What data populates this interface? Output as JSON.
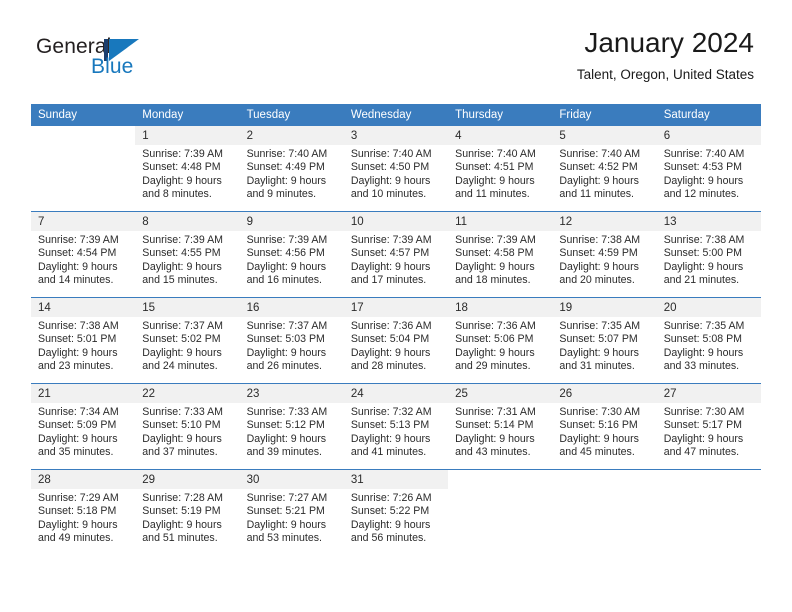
{
  "brand": {
    "name_part1": "General",
    "name_part2": "Blue",
    "mark": "triangle-flag-logo",
    "accent_color": "#1878bd",
    "dark_color": "#1c3f6e"
  },
  "header": {
    "month_title": "January 2024",
    "location": "Talent, Oregon, United States"
  },
  "theme": {
    "header_blue": "#3a7cbe",
    "daynum_band": "#f1f1f1",
    "text": "#2b2b2b"
  },
  "calendar": {
    "weekday_headers": [
      "Sunday",
      "Monday",
      "Tuesday",
      "Wednesday",
      "Thursday",
      "Friday",
      "Saturday"
    ],
    "weeks": [
      {
        "days": [
          {
            "num": "",
            "sunrise": "",
            "sunset": "",
            "daylight1": "",
            "daylight2": ""
          },
          {
            "num": "1",
            "sunrise": "Sunrise: 7:39 AM",
            "sunset": "Sunset: 4:48 PM",
            "daylight1": "Daylight: 9 hours",
            "daylight2": "and 8 minutes."
          },
          {
            "num": "2",
            "sunrise": "Sunrise: 7:40 AM",
            "sunset": "Sunset: 4:49 PM",
            "daylight1": "Daylight: 9 hours",
            "daylight2": "and 9 minutes."
          },
          {
            "num": "3",
            "sunrise": "Sunrise: 7:40 AM",
            "sunset": "Sunset: 4:50 PM",
            "daylight1": "Daylight: 9 hours",
            "daylight2": "and 10 minutes."
          },
          {
            "num": "4",
            "sunrise": "Sunrise: 7:40 AM",
            "sunset": "Sunset: 4:51 PM",
            "daylight1": "Daylight: 9 hours",
            "daylight2": "and 11 minutes."
          },
          {
            "num": "5",
            "sunrise": "Sunrise: 7:40 AM",
            "sunset": "Sunset: 4:52 PM",
            "daylight1": "Daylight: 9 hours",
            "daylight2": "and 11 minutes."
          },
          {
            "num": "6",
            "sunrise": "Sunrise: 7:40 AM",
            "sunset": "Sunset: 4:53 PM",
            "daylight1": "Daylight: 9 hours",
            "daylight2": "and 12 minutes."
          }
        ]
      },
      {
        "days": [
          {
            "num": "7",
            "sunrise": "Sunrise: 7:39 AM",
            "sunset": "Sunset: 4:54 PM",
            "daylight1": "Daylight: 9 hours",
            "daylight2": "and 14 minutes."
          },
          {
            "num": "8",
            "sunrise": "Sunrise: 7:39 AM",
            "sunset": "Sunset: 4:55 PM",
            "daylight1": "Daylight: 9 hours",
            "daylight2": "and 15 minutes."
          },
          {
            "num": "9",
            "sunrise": "Sunrise: 7:39 AM",
            "sunset": "Sunset: 4:56 PM",
            "daylight1": "Daylight: 9 hours",
            "daylight2": "and 16 minutes."
          },
          {
            "num": "10",
            "sunrise": "Sunrise: 7:39 AM",
            "sunset": "Sunset: 4:57 PM",
            "daylight1": "Daylight: 9 hours",
            "daylight2": "and 17 minutes."
          },
          {
            "num": "11",
            "sunrise": "Sunrise: 7:39 AM",
            "sunset": "Sunset: 4:58 PM",
            "daylight1": "Daylight: 9 hours",
            "daylight2": "and 18 minutes."
          },
          {
            "num": "12",
            "sunrise": "Sunrise: 7:38 AM",
            "sunset": "Sunset: 4:59 PM",
            "daylight1": "Daylight: 9 hours",
            "daylight2": "and 20 minutes."
          },
          {
            "num": "13",
            "sunrise": "Sunrise: 7:38 AM",
            "sunset": "Sunset: 5:00 PM",
            "daylight1": "Daylight: 9 hours",
            "daylight2": "and 21 minutes."
          }
        ]
      },
      {
        "days": [
          {
            "num": "14",
            "sunrise": "Sunrise: 7:38 AM",
            "sunset": "Sunset: 5:01 PM",
            "daylight1": "Daylight: 9 hours",
            "daylight2": "and 23 minutes."
          },
          {
            "num": "15",
            "sunrise": "Sunrise: 7:37 AM",
            "sunset": "Sunset: 5:02 PM",
            "daylight1": "Daylight: 9 hours",
            "daylight2": "and 24 minutes."
          },
          {
            "num": "16",
            "sunrise": "Sunrise: 7:37 AM",
            "sunset": "Sunset: 5:03 PM",
            "daylight1": "Daylight: 9 hours",
            "daylight2": "and 26 minutes."
          },
          {
            "num": "17",
            "sunrise": "Sunrise: 7:36 AM",
            "sunset": "Sunset: 5:04 PM",
            "daylight1": "Daylight: 9 hours",
            "daylight2": "and 28 minutes."
          },
          {
            "num": "18",
            "sunrise": "Sunrise: 7:36 AM",
            "sunset": "Sunset: 5:06 PM",
            "daylight1": "Daylight: 9 hours",
            "daylight2": "and 29 minutes."
          },
          {
            "num": "19",
            "sunrise": "Sunrise: 7:35 AM",
            "sunset": "Sunset: 5:07 PM",
            "daylight1": "Daylight: 9 hours",
            "daylight2": "and 31 minutes."
          },
          {
            "num": "20",
            "sunrise": "Sunrise: 7:35 AM",
            "sunset": "Sunset: 5:08 PM",
            "daylight1": "Daylight: 9 hours",
            "daylight2": "and 33 minutes."
          }
        ]
      },
      {
        "days": [
          {
            "num": "21",
            "sunrise": "Sunrise: 7:34 AM",
            "sunset": "Sunset: 5:09 PM",
            "daylight1": "Daylight: 9 hours",
            "daylight2": "and 35 minutes."
          },
          {
            "num": "22",
            "sunrise": "Sunrise: 7:33 AM",
            "sunset": "Sunset: 5:10 PM",
            "daylight1": "Daylight: 9 hours",
            "daylight2": "and 37 minutes."
          },
          {
            "num": "23",
            "sunrise": "Sunrise: 7:33 AM",
            "sunset": "Sunset: 5:12 PM",
            "daylight1": "Daylight: 9 hours",
            "daylight2": "and 39 minutes."
          },
          {
            "num": "24",
            "sunrise": "Sunrise: 7:32 AM",
            "sunset": "Sunset: 5:13 PM",
            "daylight1": "Daylight: 9 hours",
            "daylight2": "and 41 minutes."
          },
          {
            "num": "25",
            "sunrise": "Sunrise: 7:31 AM",
            "sunset": "Sunset: 5:14 PM",
            "daylight1": "Daylight: 9 hours",
            "daylight2": "and 43 minutes."
          },
          {
            "num": "26",
            "sunrise": "Sunrise: 7:30 AM",
            "sunset": "Sunset: 5:16 PM",
            "daylight1": "Daylight: 9 hours",
            "daylight2": "and 45 minutes."
          },
          {
            "num": "27",
            "sunrise": "Sunrise: 7:30 AM",
            "sunset": "Sunset: 5:17 PM",
            "daylight1": "Daylight: 9 hours",
            "daylight2": "and 47 minutes."
          }
        ]
      },
      {
        "days": [
          {
            "num": "28",
            "sunrise": "Sunrise: 7:29 AM",
            "sunset": "Sunset: 5:18 PM",
            "daylight1": "Daylight: 9 hours",
            "daylight2": "and 49 minutes."
          },
          {
            "num": "29",
            "sunrise": "Sunrise: 7:28 AM",
            "sunset": "Sunset: 5:19 PM",
            "daylight1": "Daylight: 9 hours",
            "daylight2": "and 51 minutes."
          },
          {
            "num": "30",
            "sunrise": "Sunrise: 7:27 AM",
            "sunset": "Sunset: 5:21 PM",
            "daylight1": "Daylight: 9 hours",
            "daylight2": "and 53 minutes."
          },
          {
            "num": "31",
            "sunrise": "Sunrise: 7:26 AM",
            "sunset": "Sunset: 5:22 PM",
            "daylight1": "Daylight: 9 hours",
            "daylight2": "and 56 minutes."
          },
          {
            "num": "",
            "sunrise": "",
            "sunset": "",
            "daylight1": "",
            "daylight2": ""
          },
          {
            "num": "",
            "sunrise": "",
            "sunset": "",
            "daylight1": "",
            "daylight2": ""
          },
          {
            "num": "",
            "sunrise": "",
            "sunset": "",
            "daylight1": "",
            "daylight2": ""
          }
        ]
      }
    ]
  }
}
